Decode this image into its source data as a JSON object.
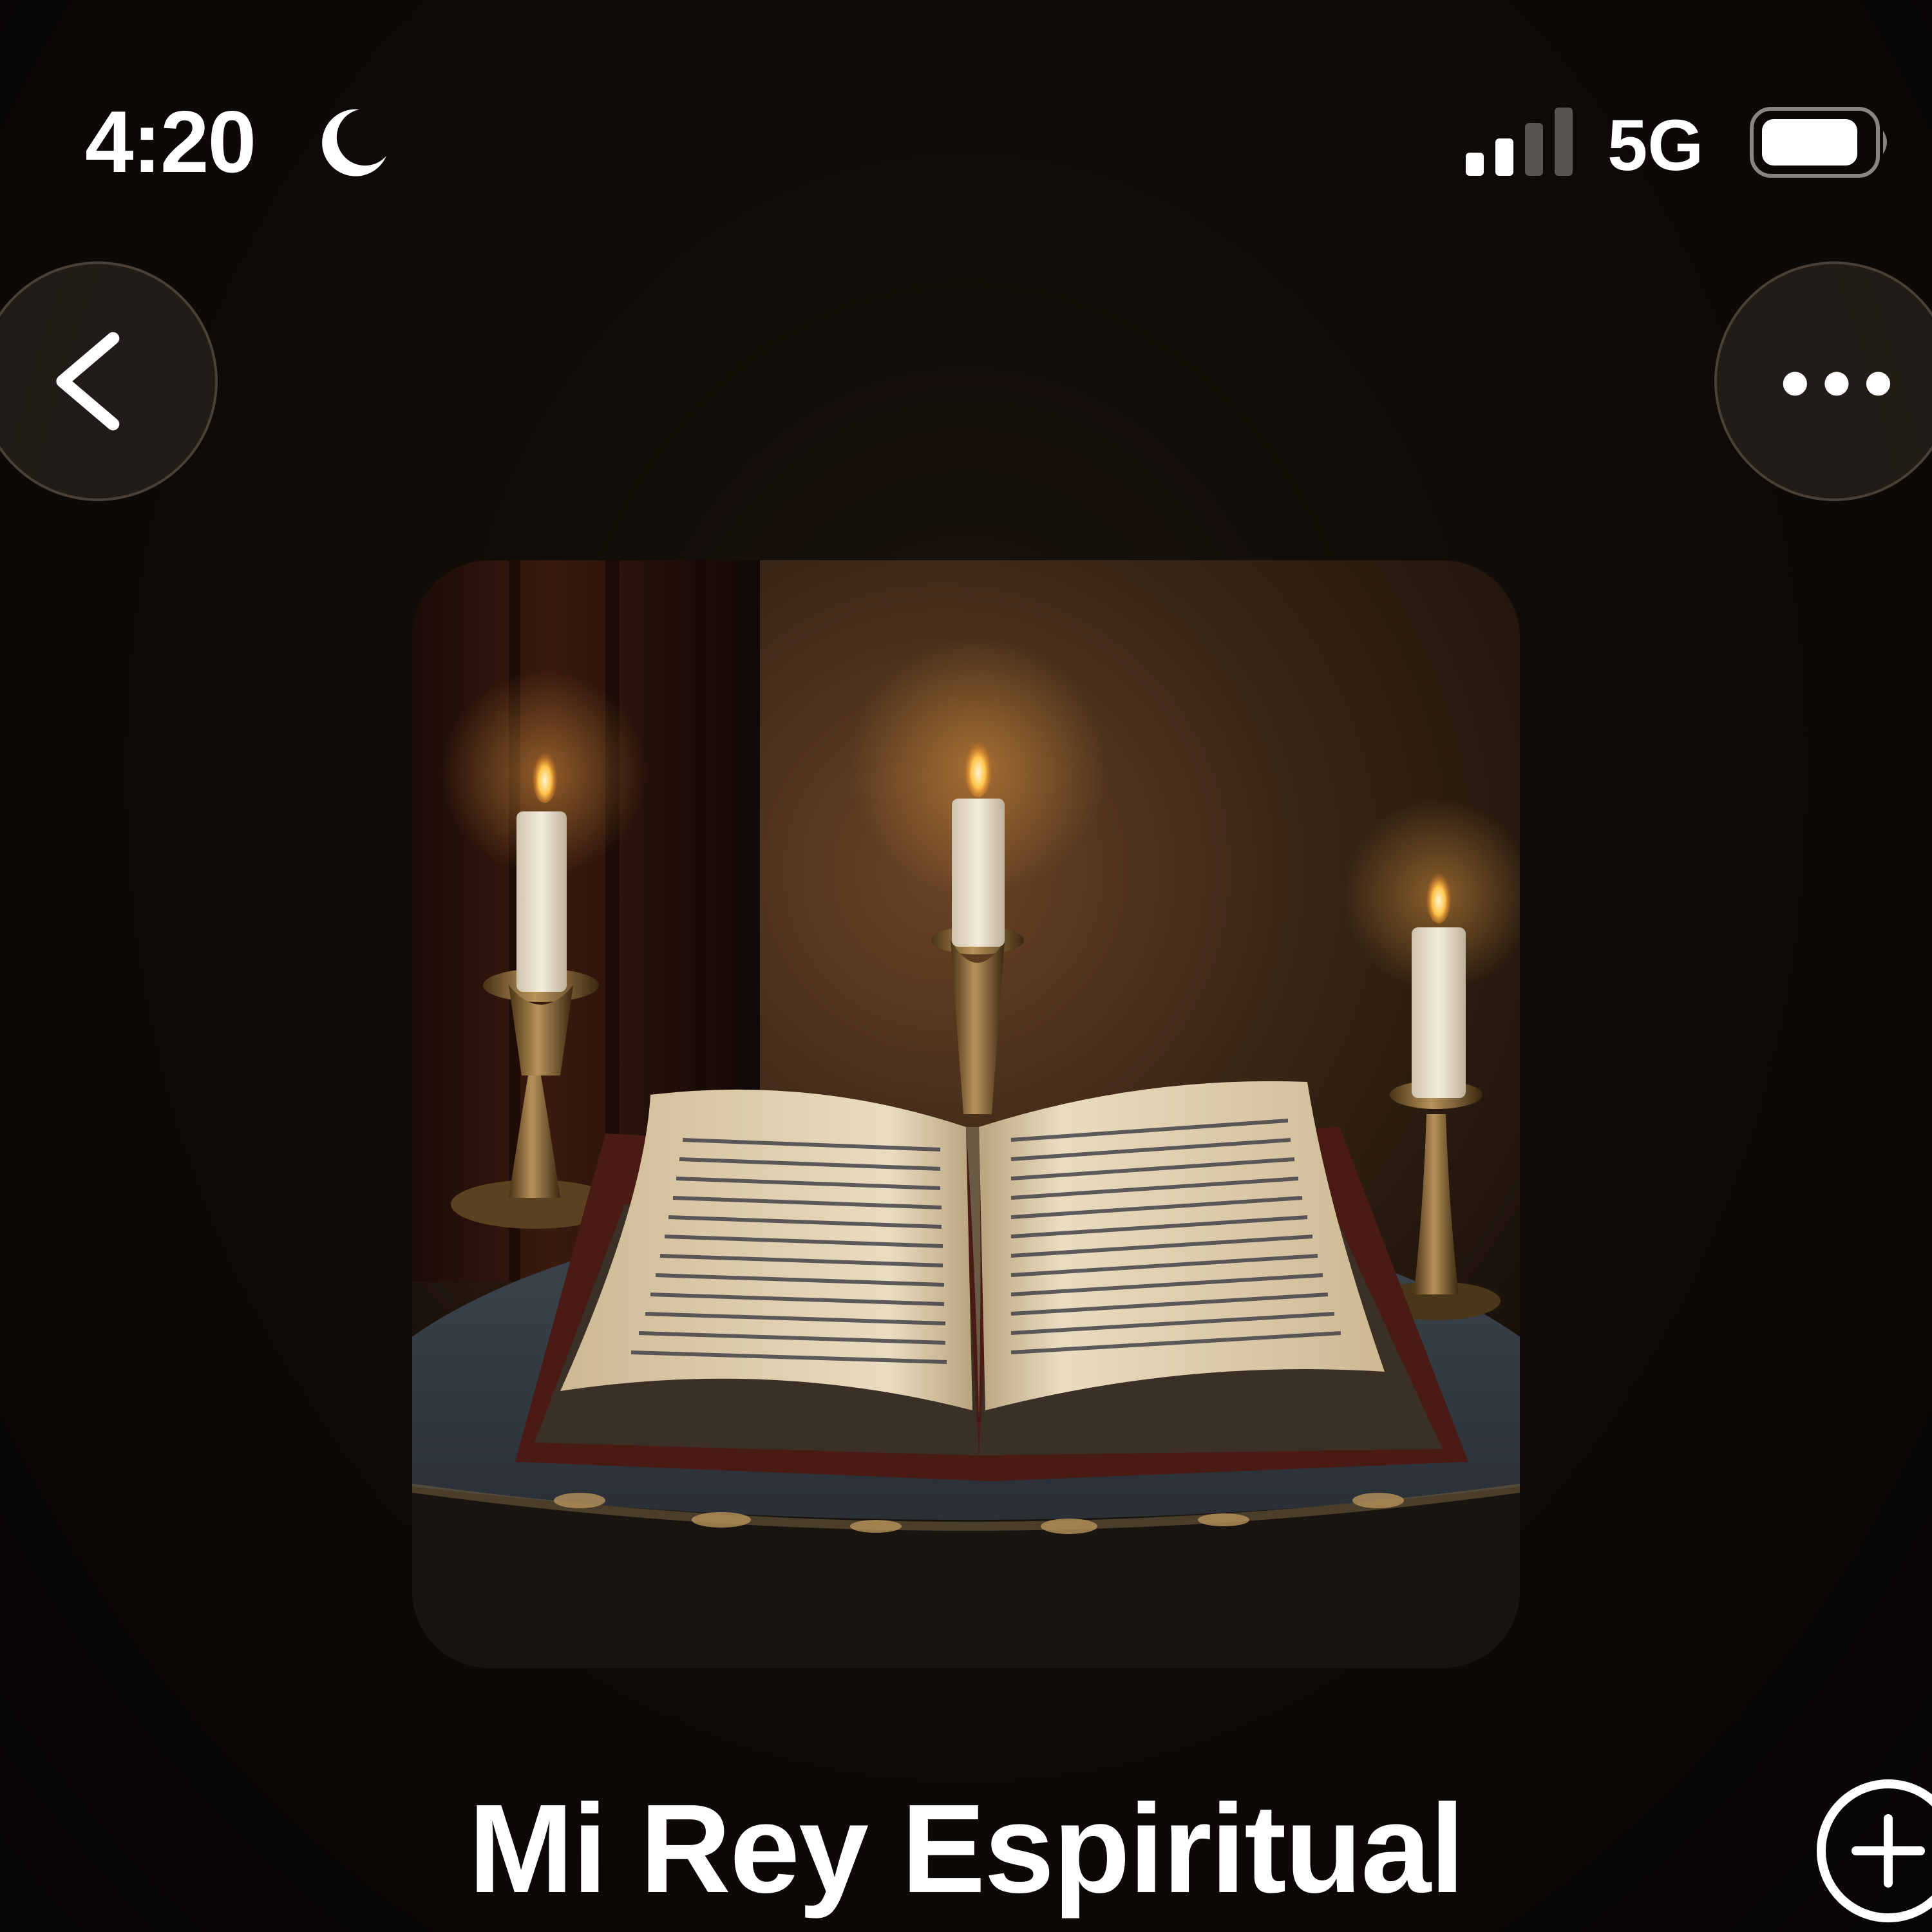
{
  "status_bar": {
    "time": "4:20",
    "network": "5G",
    "focus_icon": "moon-icon",
    "signal_icon": "cellular-signal-icon",
    "battery_icon": "battery-icon",
    "signal_bars_active": 2,
    "signal_bars_total": 4
  },
  "navigation": {
    "back_icon": "chevron-left-icon",
    "more_icon": "ellipsis-icon"
  },
  "artwork": {
    "description_icon": "album-artwork"
  },
  "playlist": {
    "title": "Mi Rey Espiritual",
    "add_icon": "plus-circle-icon"
  },
  "colors": {
    "background": "#0e0a07",
    "text": "#ffffff",
    "button_fill": "#342c26"
  }
}
